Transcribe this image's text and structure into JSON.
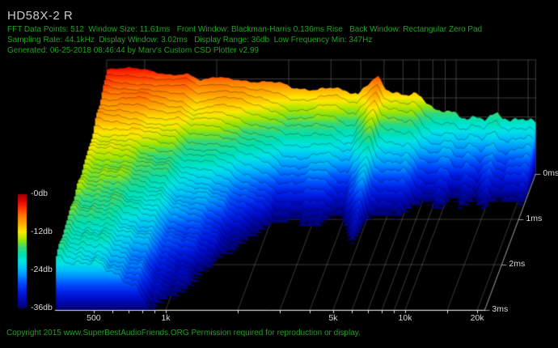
{
  "header": {
    "title": "HD58X-2 R",
    "line1": "FFT Data Points: 512  Window Size: 11.61ms   Front Window: Blackman-Harris 0.136ms Rise   Back Window: Rectangular Zero Pad",
    "line2": "Sampling Rate: 44.1kHz  Display Window: 3.02ms   Display Range: 36db  Low Frequency Min: 347Hz",
    "line3": "Generated: 06-25-2018 08:46:44 by Marv's Custom CSD Plotter v2.99"
  },
  "footer": {
    "copyright": "Copyright 2015 www.SuperBestAudioFriends.ORG Permission required for reproduction or display."
  },
  "colors": {
    "background": "#000000",
    "header_green": "#1fa11f",
    "title_gray": "#c9c9c9",
    "tick_label_gray": "#dadada",
    "wall_grid": "rgba(145,145,145,0.55)",
    "floor_grid": "rgba(155,155,155,0.5)",
    "edge_line": "rgba(190,190,190,0.75)",
    "axis_line": "#e6e6e6",
    "slice_stroke": "rgba(0,0,0,0.42)"
  },
  "chart_data": {
    "type": "csd-waterfall-3d-surface",
    "title": "HD58X-2 R",
    "x_axis": {
      "quantity": "frequency",
      "scale": "log",
      "min_hz": 347,
      "max_hz": 21500,
      "labeled_ticks": [
        {
          "hz": 500,
          "label": "500"
        },
        {
          "hz": 1000,
          "label": "1k"
        },
        {
          "hz": 5000,
          "label": "5k"
        },
        {
          "hz": 10000,
          "label": "10k"
        },
        {
          "hz": 20000,
          "label": "20k"
        }
      ],
      "minor_ticks_hz": [
        600,
        700,
        800,
        900,
        2000,
        3000,
        4000,
        6000,
        7000,
        8000,
        9000,
        15000
      ],
      "grid_ticks_hz": [
        500,
        1000,
        2000,
        3000,
        4000,
        5000,
        6000,
        7000,
        8000,
        9000,
        10000,
        15000,
        20000
      ]
    },
    "time_axis": {
      "quantity": "decay time",
      "unit": "ms",
      "display_window_ms": 3.02,
      "ticks": [
        {
          "ms": 0,
          "label": "0ms"
        },
        {
          "ms": 1,
          "label": "1ms"
        },
        {
          "ms": 2,
          "label": "2ms"
        },
        {
          "ms": 3,
          "label": "3ms"
        }
      ]
    },
    "amplitude_axis": {
      "quantity": "level",
      "unit": "db",
      "range_db": 36,
      "legend_ticks": [
        {
          "db": 0,
          "label": "-0db"
        },
        {
          "db": -12,
          "label": "-12db"
        },
        {
          "db": -24,
          "label": "-24db"
        },
        {
          "db": -36,
          "label": "-36db"
        }
      ]
    },
    "colormap": [
      [
        0.0,
        "#a00000"
      ],
      [
        0.05,
        "#d80000"
      ],
      [
        0.11,
        "#ff2800"
      ],
      [
        0.19,
        "#ff7800"
      ],
      [
        0.27,
        "#ffb600"
      ],
      [
        0.33,
        "#ffe800"
      ],
      [
        0.4,
        "#9ee600"
      ],
      [
        0.47,
        "#34d878"
      ],
      [
        0.53,
        "#00e0b4"
      ],
      [
        0.59,
        "#00e4e4"
      ],
      [
        0.65,
        "#00c2f8"
      ],
      [
        0.71,
        "#0090ff"
      ],
      [
        0.77,
        "#0052ff"
      ],
      [
        0.84,
        "#0022e8"
      ],
      [
        0.91,
        "#000ac0"
      ],
      [
        1.0,
        "#000070"
      ]
    ],
    "response": {
      "decay_breakpoint_ms": 1.0,
      "freq_hz": [
        347,
        430,
        520,
        640,
        760,
        860,
        980,
        1100,
        1350,
        1700,
        2100,
        2600,
        3100,
        3600,
        3900,
        4300,
        4700,
        5100,
        5600,
        6100,
        6800,
        7600,
        8400,
        9400,
        10500,
        11800,
        13200,
        14900,
        16800,
        18500,
        20300,
        21500
      ],
      "db_at_0ms": [
        -3.2,
        -3.0,
        -3.6,
        -4.3,
        -4.8,
        -6.8,
        -5.0,
        -5.2,
        -6.0,
        -7.5,
        -9.0,
        -9.5,
        -8.5,
        -10.5,
        -11.5,
        -7.5,
        -4.2,
        -8.0,
        -9.8,
        -11.0,
        -10.6,
        -13.5,
        -17.0,
        -16.5,
        -18.0,
        -17.5,
        -19.0,
        -17.8,
        -19.3,
        -18.0,
        -18.8,
        -19.5
      ],
      "decay_early_db_per_ms": [
        9,
        9.5,
        10,
        11,
        12,
        13,
        15,
        16,
        18,
        21,
        24,
        25,
        23,
        25,
        26,
        23,
        22,
        26,
        28,
        26,
        26,
        28,
        29,
        24,
        28,
        24,
        27,
        24,
        26,
        24,
        25,
        25
      ],
      "decay_late_db_per_ms": [
        3.5,
        4,
        4.5,
        5,
        6.5,
        7.5,
        8,
        9,
        11,
        14,
        18,
        19,
        18,
        19,
        20,
        17,
        16,
        20,
        21,
        20,
        20,
        21,
        22,
        18,
        21,
        19,
        20,
        19,
        20,
        19,
        20,
        20
      ]
    },
    "slice_count": 40,
    "legend_position": "left"
  }
}
